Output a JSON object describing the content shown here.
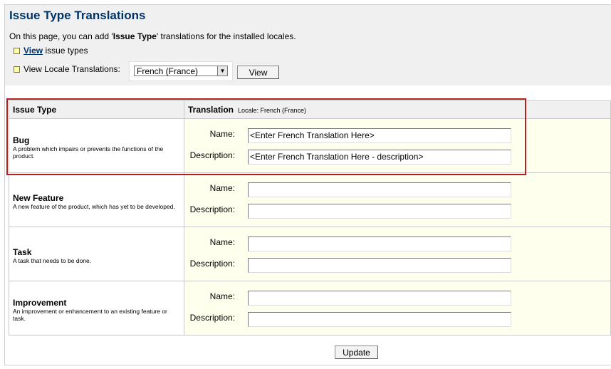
{
  "header": {
    "title": "Issue Type Translations",
    "intro_before": "On this page, you can add '",
    "intro_bold": "Issue Type",
    "intro_after": "' translations for the installed locales."
  },
  "nav": {
    "view_link": "View",
    "view_suffix": " issue types",
    "locale_label": "View Locale Translations:",
    "locale_selected": "French (France)",
    "view_button": "View"
  },
  "table": {
    "col_issue_type": "Issue Type",
    "col_translation": "Translation",
    "locale_note": "Locale: French (France)",
    "name_label": "Name:",
    "description_label": "Description:",
    "rows": [
      {
        "name": "Bug",
        "description": "A problem which impairs or prevents the functions of the product.",
        "name_value": "<Enter French Translation Here>",
        "description_value": "<Enter French Translation Here - description>"
      },
      {
        "name": "New Feature",
        "description": "A new feature of the product, which has yet to be developed.",
        "name_value": "",
        "description_value": ""
      },
      {
        "name": "Task",
        "description": "A task that needs to be done.",
        "name_value": "",
        "description_value": ""
      },
      {
        "name": "Improvement",
        "description": "An improvement or enhancement to an existing feature or task.",
        "name_value": "",
        "description_value": ""
      }
    ]
  },
  "footer": {
    "update_button": "Update"
  },
  "colors": {
    "title": "#003366",
    "highlight": "#b11f1f",
    "row_bg": "#ffffee"
  }
}
